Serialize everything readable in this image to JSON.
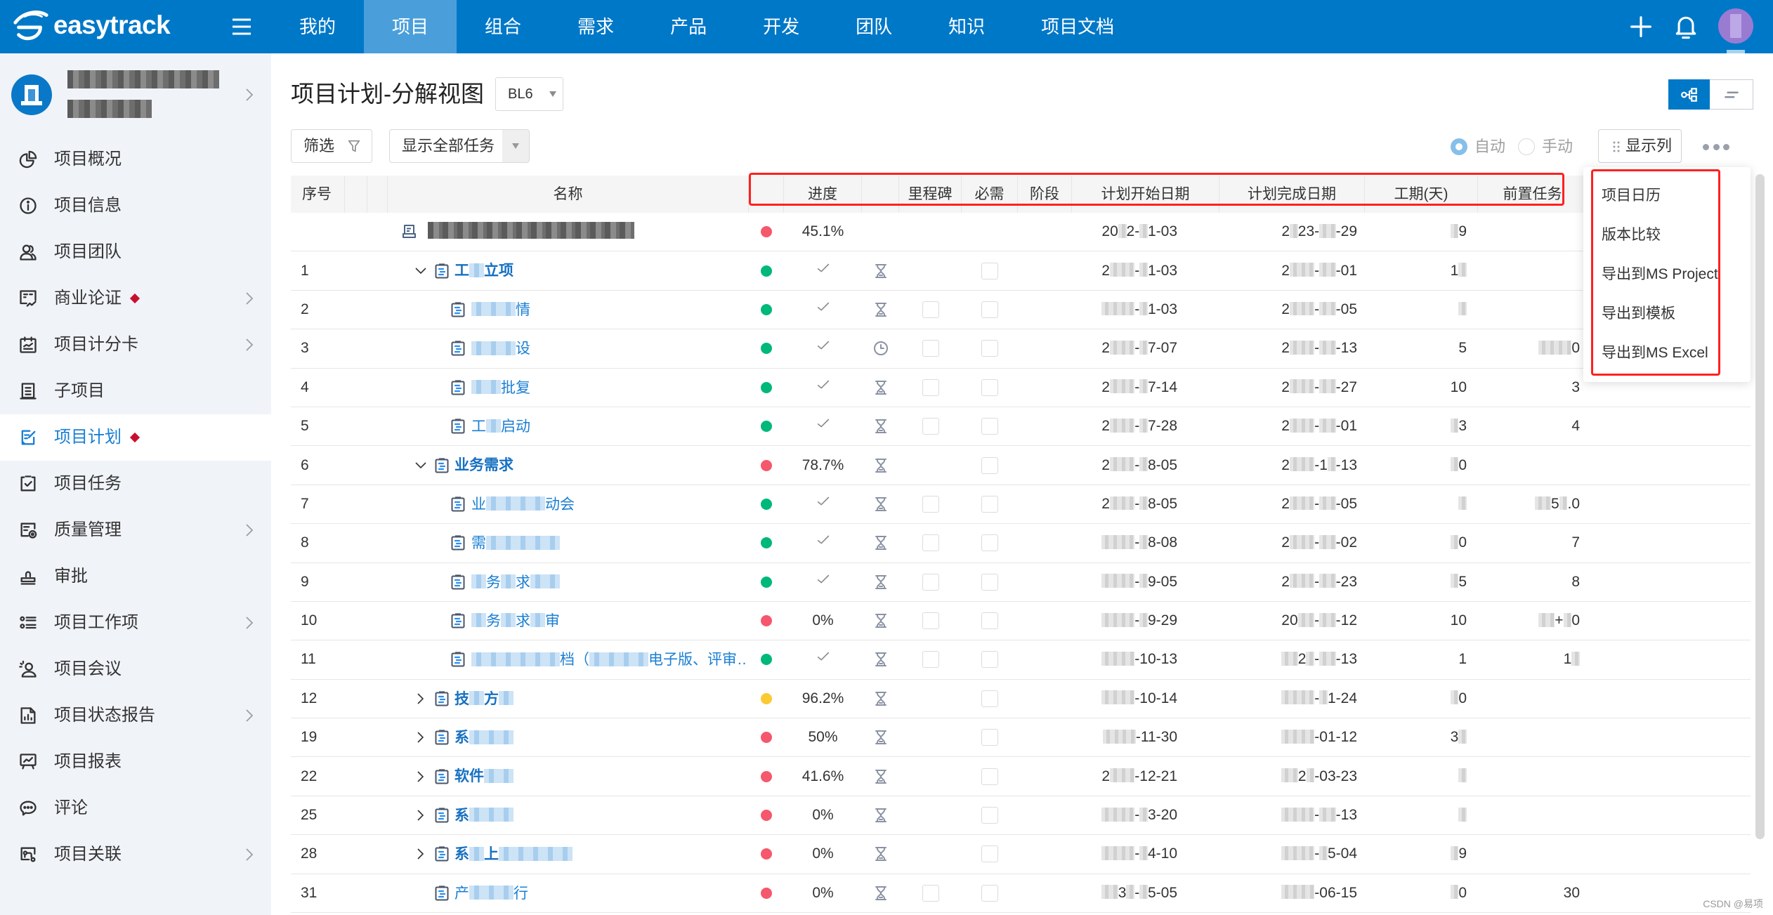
{
  "colors": {
    "brand": "#0078c8",
    "nav_active": "#4a9fdb",
    "link": "#1a7fd4",
    "badge": "#c8102e",
    "highlight": "#ff2020",
    "status": {
      "red": "#f5576c",
      "green": "#00b87a",
      "yellow": "#fbc932"
    }
  },
  "app": {
    "logo_text": "easytrack",
    "logo_icon": "easytrack-logo-icon"
  },
  "topnav": {
    "items": [
      "我的",
      "项目",
      "组合",
      "需求",
      "产品",
      "开发",
      "团队",
      "知识",
      "项目文档"
    ],
    "active_index": 1,
    "menu_icon": "hamburger-icon",
    "add_icon": "plus-icon",
    "notify_icon": "bell-icon"
  },
  "sidebar": {
    "project": {
      "name": "▇▇▇▇▇▇▇▇▇",
      "code": "▇▇▇▇▇"
    },
    "active_index": 6,
    "items": [
      {
        "label": "项目概况",
        "icon": "pie-chart-icon",
        "chevron": false,
        "badge": false
      },
      {
        "label": "项目信息",
        "icon": "info-circle-icon",
        "chevron": false,
        "badge": false
      },
      {
        "label": "项目团队",
        "icon": "team-icon",
        "chevron": false,
        "badge": false
      },
      {
        "label": "商业论证",
        "icon": "business-case-icon",
        "chevron": true,
        "badge": true
      },
      {
        "label": "项目计分卡",
        "icon": "scorecard-icon",
        "chevron": true,
        "badge": false
      },
      {
        "label": "子项目",
        "icon": "subproject-icon",
        "chevron": false,
        "badge": false
      },
      {
        "label": "项目计划",
        "icon": "plan-icon",
        "chevron": false,
        "badge": true
      },
      {
        "label": "项目任务",
        "icon": "task-check-icon",
        "chevron": false,
        "badge": false
      },
      {
        "label": "质量管理",
        "icon": "quality-icon",
        "chevron": true,
        "badge": false
      },
      {
        "label": "审批",
        "icon": "approval-stamp-icon",
        "chevron": false,
        "badge": false
      },
      {
        "label": "项目工作项",
        "icon": "work-items-icon",
        "chevron": true,
        "badge": false
      },
      {
        "label": "项目会议",
        "icon": "meeting-icon",
        "chevron": false,
        "badge": false
      },
      {
        "label": "项目状态报告",
        "icon": "status-report-icon",
        "chevron": true,
        "badge": false
      },
      {
        "label": "项目报表",
        "icon": "report-chart-icon",
        "chevron": false,
        "badge": false
      },
      {
        "label": "评论",
        "icon": "comment-icon",
        "chevron": false,
        "badge": false
      },
      {
        "label": "项目关联",
        "icon": "relation-icon",
        "chevron": true,
        "badge": false
      }
    ]
  },
  "page": {
    "title": "项目计划-分解视图",
    "baseline": "BL6"
  },
  "toolbar": {
    "filter_label": "筛选",
    "task_filter": "显示全部任务",
    "mode_auto": "自动",
    "mode_manual": "手动",
    "mode_selected": "auto",
    "columns_label": "显示列",
    "view_active": "tree"
  },
  "table": {
    "columns": [
      "序号",
      "",
      "",
      "名称",
      "",
      "进度",
      "",
      "里程碑",
      "必需",
      "阶段",
      "计划开始日期",
      "计划完成日期",
      "工期(天)",
      "前置任务",
      ""
    ],
    "rows": [
      {
        "seq": "",
        "level": 0,
        "expand": null,
        "icon": "project",
        "name": "▇▇▇▇▇▇▇▇▇▇▇▇▇▇",
        "bold": false,
        "status": "red",
        "progress": "45.1%",
        "done": false,
        "type": null,
        "milestone": null,
        "required": null,
        "start": "20▇2-▇1-03",
        "finish": "2▇23-▇▇-29",
        "duration": "▇9",
        "pred": ""
      },
      {
        "seq": "1",
        "level": 1,
        "expand": "expanded",
        "icon": "task",
        "name": "工▇立项",
        "bold": true,
        "status": "green",
        "progress": "",
        "done": true,
        "type": "hourglass",
        "milestone": null,
        "required": false,
        "start": "2▇▇▇-▇1-03",
        "finish": "2▇▇▇-▇▇-01",
        "duration": "1▇",
        "pred": ""
      },
      {
        "seq": "2",
        "level": 2,
        "expand": null,
        "icon": "task",
        "name": "▇▇▇情",
        "bold": false,
        "status": "green",
        "progress": "",
        "done": true,
        "type": "hourglass",
        "milestone": false,
        "required": false,
        "start": "▇▇▇▇-▇1-03",
        "finish": "2▇▇▇-▇▇-05",
        "duration": "▇",
        "pred": ""
      },
      {
        "seq": "3",
        "level": 2,
        "expand": null,
        "icon": "task",
        "name": "▇▇▇设",
        "bold": false,
        "status": "green",
        "progress": "",
        "done": true,
        "type": "clock",
        "milestone": false,
        "required": false,
        "start": "2▇▇▇-▇7-07",
        "finish": "2▇▇▇-▇▇-13",
        "duration": "5",
        "pred": "▇▇▇▇0"
      },
      {
        "seq": "4",
        "level": 2,
        "expand": null,
        "icon": "task",
        "name": "▇▇批复",
        "bold": false,
        "status": "green",
        "progress": "",
        "done": true,
        "type": "hourglass",
        "milestone": false,
        "required": false,
        "start": "2▇▇▇-▇7-14",
        "finish": "2▇▇▇-▇▇-27",
        "duration": "10",
        "pred": "3"
      },
      {
        "seq": "5",
        "level": 2,
        "expand": null,
        "icon": "task",
        "name": "工▇启动",
        "bold": false,
        "status": "green",
        "progress": "",
        "done": true,
        "type": "hourglass",
        "milestone": false,
        "required": false,
        "start": "2▇▇▇-▇7-28",
        "finish": "2▇▇▇-▇▇-01",
        "duration": "▇3",
        "pred": "4"
      },
      {
        "seq": "6",
        "level": 1,
        "expand": "expanded",
        "icon": "task",
        "name": "业务需求",
        "bold": true,
        "status": "red",
        "progress": "78.7%",
        "done": false,
        "type": "hourglass",
        "milestone": null,
        "required": false,
        "start": "2▇▇▇-▇8-05",
        "finish": "2▇▇▇-1▇-13",
        "duration": "▇0",
        "pred": ""
      },
      {
        "seq": "7",
        "level": 2,
        "expand": null,
        "icon": "task",
        "name": "业▇▇▇▇动会",
        "bold": false,
        "status": "green",
        "progress": "",
        "done": true,
        "type": "hourglass",
        "milestone": false,
        "required": false,
        "start": "2▇▇▇-▇8-05",
        "finish": "2▇▇▇-▇▇-05",
        "duration": "▇",
        "pred": "▇▇5▇.0"
      },
      {
        "seq": "8",
        "level": 2,
        "expand": null,
        "icon": "task",
        "name": "需▇▇▇▇▇",
        "bold": false,
        "status": "green",
        "progress": "",
        "done": true,
        "type": "hourglass",
        "milestone": false,
        "required": false,
        "start": "▇▇▇▇-▇8-08",
        "finish": "2▇▇▇-▇▇-02",
        "duration": "▇0",
        "pred": "7"
      },
      {
        "seq": "9",
        "level": 2,
        "expand": null,
        "icon": "task",
        "name": "▇务▇求▇▇",
        "bold": false,
        "status": "green",
        "progress": "",
        "done": true,
        "type": "hourglass",
        "milestone": false,
        "required": false,
        "start": "▇▇▇▇-▇9-05",
        "finish": "2▇▇▇-▇▇-23",
        "duration": "▇5",
        "pred": "8"
      },
      {
        "seq": "10",
        "level": 2,
        "expand": null,
        "icon": "task",
        "name": "▇务▇求▇审",
        "bold": false,
        "status": "red",
        "progress": "0%",
        "done": false,
        "type": "hourglass",
        "milestone": false,
        "required": false,
        "start": "▇▇▇▇-▇9-29",
        "finish": "20▇▇-▇▇-12",
        "duration": "10",
        "pred": "▇▇+▇0"
      },
      {
        "seq": "11",
        "level": 2,
        "expand": null,
        "icon": "task",
        "name": "▇▇▇▇▇▇档（▇▇▇▇电子版、评审…",
        "bold": false,
        "status": "green",
        "progress": "",
        "done": true,
        "type": "hourglass",
        "milestone": false,
        "required": false,
        "start": "▇▇▇▇-10-13",
        "finish": "▇▇2▇-▇▇-13",
        "duration": "1",
        "pred": "1▇"
      },
      {
        "seq": "12",
        "level": 1,
        "expand": "collapsed",
        "icon": "task",
        "name": "技▇方▇",
        "bold": true,
        "status": "yellow",
        "progress": "96.2%",
        "done": false,
        "type": "hourglass",
        "milestone": null,
        "required": false,
        "start": "▇▇▇▇-10-14",
        "finish": "▇▇▇▇-▇1-24",
        "duration": "▇0",
        "pred": ""
      },
      {
        "seq": "19",
        "level": 1,
        "expand": "collapsed",
        "icon": "task",
        "name": "系▇▇▇",
        "bold": true,
        "status": "red",
        "progress": "50%",
        "done": false,
        "type": "hourglass",
        "milestone": null,
        "required": false,
        "start": "▇▇▇▇-11-30",
        "finish": "▇▇▇▇-01-12",
        "duration": "3▇",
        "pred": ""
      },
      {
        "seq": "22",
        "level": 1,
        "expand": "collapsed",
        "icon": "task",
        "name": "软件▇▇",
        "bold": true,
        "status": "red",
        "progress": "41.6%",
        "done": false,
        "type": "hourglass",
        "milestone": null,
        "required": false,
        "start": "2▇▇▇-12-21",
        "finish": "▇▇2▇-03-23",
        "duration": "▇",
        "pred": ""
      },
      {
        "seq": "25",
        "level": 1,
        "expand": "collapsed",
        "icon": "task",
        "name": "系▇▇▇",
        "bold": true,
        "status": "red",
        "progress": "0%",
        "done": false,
        "type": "hourglass",
        "milestone": null,
        "required": false,
        "start": "▇▇▇▇-▇3-20",
        "finish": "▇▇▇▇-▇▇-13",
        "duration": "▇",
        "pred": ""
      },
      {
        "seq": "28",
        "level": 1,
        "expand": "collapsed",
        "icon": "task",
        "name": "系▇上▇▇▇▇▇",
        "bold": true,
        "status": "red",
        "progress": "0%",
        "done": false,
        "type": "hourglass",
        "milestone": null,
        "required": false,
        "start": "▇▇▇▇-▇4-10",
        "finish": "▇▇▇▇-▇5-04",
        "duration": "▇9",
        "pred": ""
      },
      {
        "seq": "31",
        "level": 1,
        "expand": null,
        "icon": "task",
        "name": "产▇▇▇行",
        "bold": false,
        "status": "red",
        "progress": "0%",
        "done": false,
        "type": "hourglass",
        "milestone": false,
        "required": false,
        "start": "▇▇3▇-▇5-05",
        "finish": "▇▇▇▇-06-15",
        "duration": "▇0",
        "pred": "30"
      }
    ]
  },
  "more_menu": {
    "items": [
      "项目日历",
      "版本比较",
      "导出到MS Project",
      "导出到模板",
      "导出到MS Excel"
    ]
  },
  "watermark": "CSDN @易项"
}
